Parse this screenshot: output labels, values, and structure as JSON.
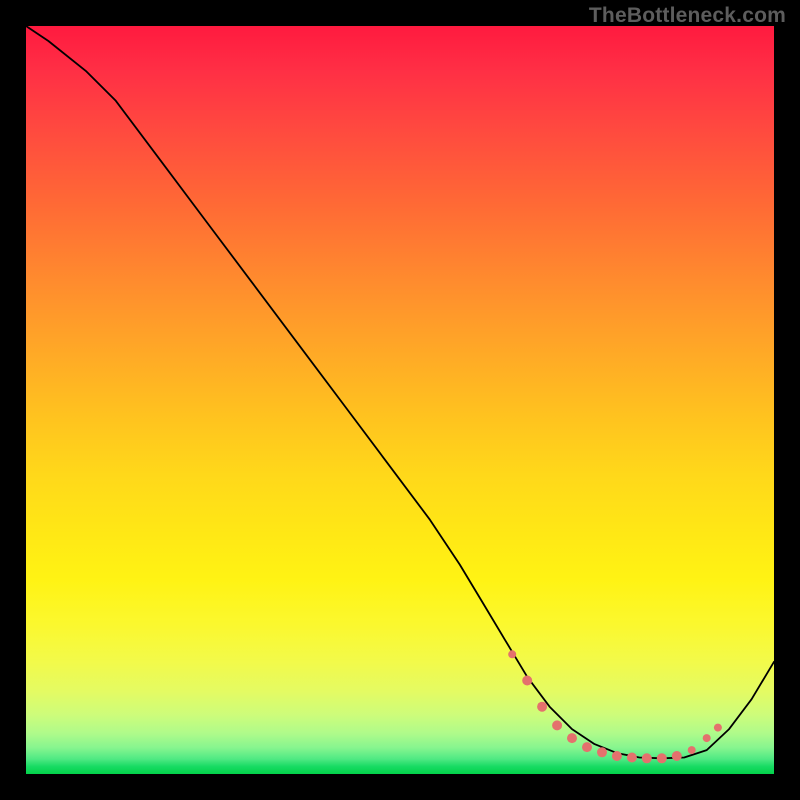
{
  "watermark": "TheBottleneck.com",
  "chart_data": {
    "type": "line",
    "title": "",
    "xlabel": "",
    "ylabel": "",
    "xlim": [
      0,
      100
    ],
    "ylim": [
      0,
      100
    ],
    "grid": false,
    "series": [
      {
        "name": "curve",
        "x": [
          0,
          3,
          8,
          12,
          18,
          24,
          30,
          36,
          42,
          48,
          54,
          58,
          61,
          64,
          67,
          70,
          73,
          76,
          79,
          82,
          85,
          88,
          91,
          94,
          97,
          100
        ],
        "y": [
          100,
          98,
          94,
          90,
          82,
          74,
          66,
          58,
          50,
          42,
          34,
          28,
          23,
          18,
          13,
          9,
          6,
          4,
          2.8,
          2.2,
          2.1,
          2.2,
          3.2,
          6,
          10,
          15
        ]
      }
    ],
    "markers": {
      "name": "highlight-points",
      "color": "#e4716d",
      "points": [
        {
          "x": 65,
          "y": 16,
          "r": 4
        },
        {
          "x": 67,
          "y": 12.5,
          "r": 5
        },
        {
          "x": 69,
          "y": 9,
          "r": 5
        },
        {
          "x": 71,
          "y": 6.5,
          "r": 5
        },
        {
          "x": 73,
          "y": 4.8,
          "r": 5
        },
        {
          "x": 75,
          "y": 3.6,
          "r": 5
        },
        {
          "x": 77,
          "y": 2.9,
          "r": 5
        },
        {
          "x": 79,
          "y": 2.4,
          "r": 5
        },
        {
          "x": 81,
          "y": 2.2,
          "r": 5
        },
        {
          "x": 83,
          "y": 2.1,
          "r": 5
        },
        {
          "x": 85,
          "y": 2.1,
          "r": 5
        },
        {
          "x": 87,
          "y": 2.4,
          "r": 5
        },
        {
          "x": 89,
          "y": 3.2,
          "r": 4
        },
        {
          "x": 91,
          "y": 4.8,
          "r": 4
        },
        {
          "x": 92.5,
          "y": 6.2,
          "r": 4
        }
      ]
    }
  }
}
